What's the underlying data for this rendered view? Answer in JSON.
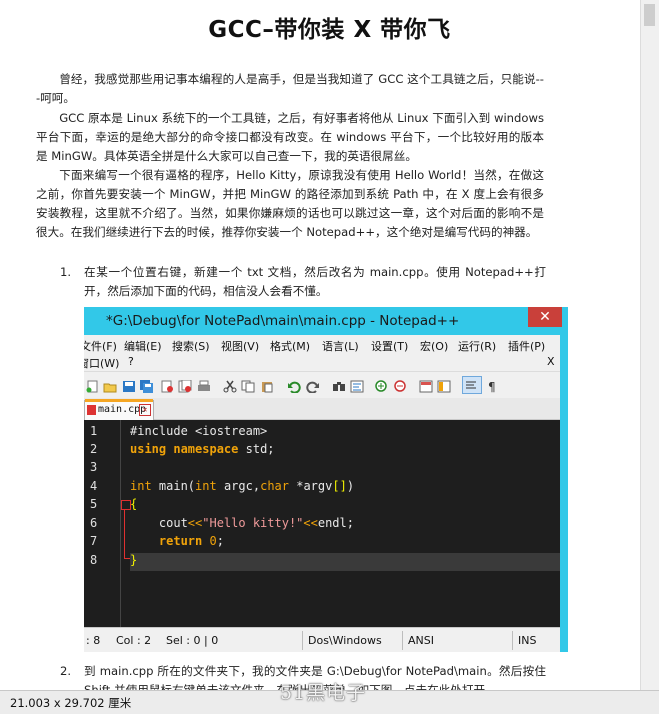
{
  "document": {
    "title": "GCC–带你装 X 带你飞",
    "paragraphs": [
      "曾经，我感觉那些用记事本编程的人是高手，但是当我知道了 GCC 这个工具链之后，只能说---呵呵。",
      "GCC 原本是 Linux 系统下的一个工具链，之后，有好事者将他从 Linux 下面引入到 windows 平台下面，幸运的是绝大部分的命令接口都没有改变。在 windows 平台下，一个比较好用的版本是 MinGW。具体英语全拼是什么大家可以自己查一下，我的英语很屌丝。",
      "下面来编写一个很有逼格的程序，Hello Kitty，原谅我没有使用 Hello World！当然，在做这之前，你首先要安装一个 MinGW，并把 MinGW 的路径添加到系统 Path 中，在 X 度上会有很多安装教程，这里就不介绍了。当然，如果你嫌麻烦的话也可以跳过这一章，这个对后面的影响不是很大。在我们继续进行下去的时候，推荐你安装一个 Notepad++，这个绝对是编写代码的神器。"
    ],
    "list": [
      {
        "num": "1.",
        "text": "在某一个位置右键，新建一个 txt 文档，然后改名为 main.cpp。使用 Notepad++打开，然后添加下面的代码，相信没人会看不懂。"
      },
      {
        "num": "2.",
        "text": "到 main.cpp 所在的文件夹下，我的文件夹是 G:\\Debug\\for NotePad\\main。然后按住 Shift 并使用鼠标右键单击该文件夹，在弹出的菜单，如下图，点击在此处打开"
      }
    ]
  },
  "notepad": {
    "title": "*G:\\Debug\\for NotePad\\main\\main.cpp - Notepad++",
    "close_label": "✕",
    "menu_row1": [
      "文件(F)",
      "编辑(E)",
      "搜索(S)",
      "视图(V)",
      "格式(M)",
      "语言(L)",
      "设置(T)",
      "宏(O)",
      "运行(R)",
      "插件(P)"
    ],
    "menu_row2": [
      "窗口(W)",
      "?"
    ],
    "menu_row2_right": "X",
    "tab_label": "main.cpp",
    "status": {
      "lines": ": 8",
      "col": "Col : 2",
      "sel": "Sel : 0 | 0",
      "eol": "Dos\\Windows",
      "encoding": "ANSI",
      "mode": "INS"
    },
    "line_numbers": [
      "1",
      "2",
      "3",
      "4",
      "5",
      "6",
      "7",
      "8"
    ]
  },
  "code_lines": [
    "#include <iostream>",
    "using namespace std;",
    "",
    "int main(int argc,char *argv[])",
    "{",
    "    cout<<\"Hello kitty!\"<<endl;",
    "    return 0;",
    "}"
  ],
  "bottom": {
    "page_size": "21.003 x 29.702 厘米",
    "watermark": "51黑电子"
  },
  "colors": {
    "window_frame": "#32c8e8",
    "editor_bg": "#1e1e1e",
    "keyword": "#f0a30a",
    "string": "#ef9a9a",
    "fold_marker": "#e03030"
  }
}
